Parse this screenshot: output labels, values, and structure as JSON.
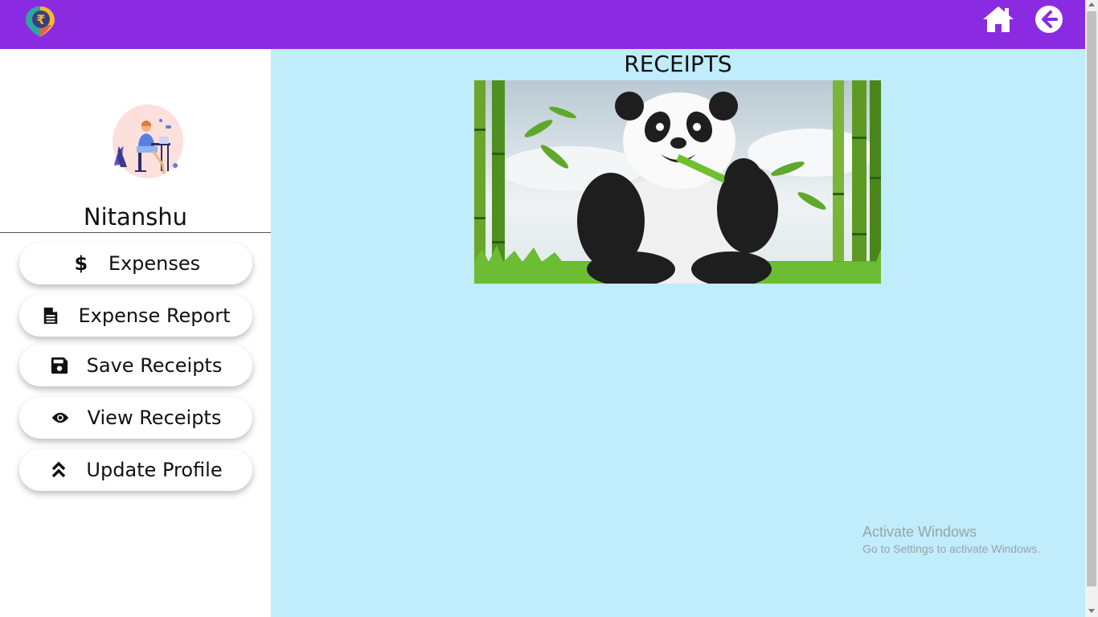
{
  "header": {
    "logo_icon": "rupee-location-pin-logo",
    "home_icon": "home-icon",
    "back_icon": "arrow-left-circle-icon",
    "bg_color": "#8a2be2"
  },
  "sidebar": {
    "user_name": "Nitanshu",
    "avatar_icon": "person-at-laptop-illustration",
    "items": [
      {
        "label": "Expenses",
        "icon": "dollar-icon"
      },
      {
        "label": "Expense Report",
        "icon": "file-text-icon"
      },
      {
        "label": "Save Receipts",
        "icon": "floppy-disk-icon"
      },
      {
        "label": "View Receipts",
        "icon": "eye-icon"
      },
      {
        "label": "Update Profile",
        "icon": "double-chevron-up-icon"
      }
    ]
  },
  "main": {
    "title": "RECEIPTS",
    "bg_color": "#c0ecfb",
    "receipt_image": "panda-eating-bamboo-image"
  },
  "watermark": {
    "line1": "Activate Windows",
    "line2": "Go to Settings to activate Windows."
  }
}
